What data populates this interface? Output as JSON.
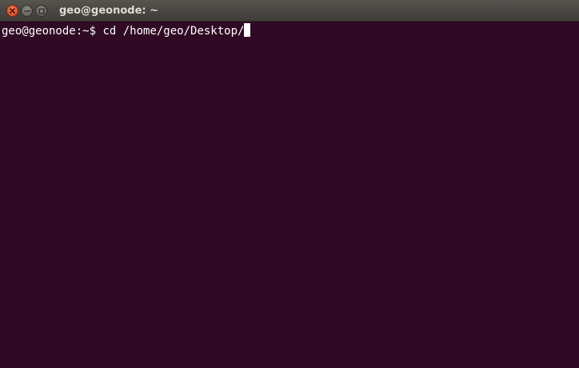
{
  "window": {
    "title": "geo@geonode: ~",
    "controls": {
      "close_icon": "close-icon",
      "minimize_icon": "minimize-icon",
      "maximize_icon": "maximize-icon"
    }
  },
  "terminal": {
    "lines": [
      {
        "prompt": "geo@geonode:~$ ",
        "command": "cd /home/geo/Desktop/"
      }
    ],
    "colors": {
      "background": "#300a24",
      "foreground": "#ffffff"
    }
  }
}
